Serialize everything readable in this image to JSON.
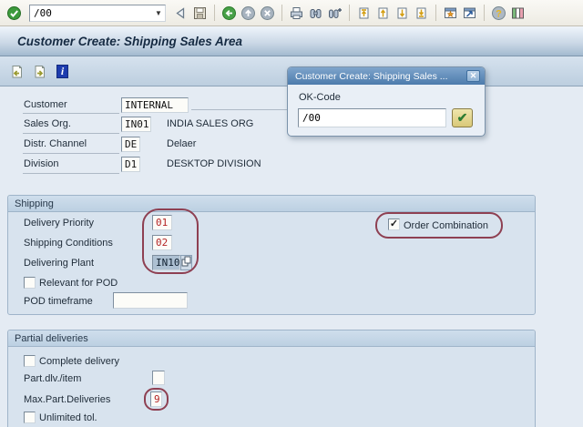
{
  "toolbar": {
    "command_value": "/00",
    "dropdown_glyph": "▼",
    "icons": [
      "enter",
      "back-triangle",
      "save",
      "back",
      "exit",
      "cancel",
      "print",
      "find",
      "find-next",
      "first-page",
      "previous-page",
      "next-page",
      "last-page",
      "new-session",
      "create-shortcut",
      "help",
      "customize-layout"
    ]
  },
  "screen": {
    "title": "Customer Create: Shipping Sales Area"
  },
  "app_toolbar": {
    "icons": [
      "previous-screen",
      "next-screen",
      "information"
    ],
    "info_glyph": "i"
  },
  "popup": {
    "title": "Customer Create: Shipping Sales ...",
    "close_glyph": "✕",
    "ok_code": {
      "label": "OK-Code",
      "value": "/00"
    },
    "confirm_glyph": "✔"
  },
  "header_fields": {
    "rows": [
      {
        "label": "Customer",
        "value": "INTERNAL",
        "desc": ""
      },
      {
        "label": "Sales Org.",
        "value": "IN01",
        "desc": "INDIA SALES ORG"
      },
      {
        "label": "Distr. Channel",
        "value": "DE",
        "desc": "Delaer"
      },
      {
        "label": "Division",
        "value": "D1",
        "desc": "DESKTOP DIVISION"
      }
    ]
  },
  "shipping": {
    "title": "Shipping",
    "delivery_priority": {
      "label": "Delivery Priority",
      "value": "01"
    },
    "shipping_conditions": {
      "label": "Shipping Conditions",
      "value": "02"
    },
    "delivering_plant": {
      "label": "Delivering Plant",
      "value": "IN10"
    },
    "relevant_for_pod": {
      "label": "Relevant for POD",
      "checked": false
    },
    "pod_timeframe": {
      "label": "POD timeframe",
      "value": ""
    },
    "order_combination": {
      "label": "Order Combination",
      "checked": true,
      "check_glyph": "✓"
    }
  },
  "partial_deliveries": {
    "title": "Partial deliveries",
    "complete_delivery": {
      "label": "Complete delivery",
      "checked": false
    },
    "part_dlv_item": {
      "label": "Part.dlv./item",
      "value": ""
    },
    "max_part_deliveries": {
      "label": "Max.Part.Deliveries",
      "value": "9"
    },
    "unlimited_tol": {
      "label": "Unlimited tol.",
      "checked": false
    }
  },
  "colors": {
    "highlight_value": "#b42525",
    "annotation": "#8e4052",
    "selected_field_bg": "#adc0d2",
    "popup_titlebar": "#5d89b8"
  }
}
